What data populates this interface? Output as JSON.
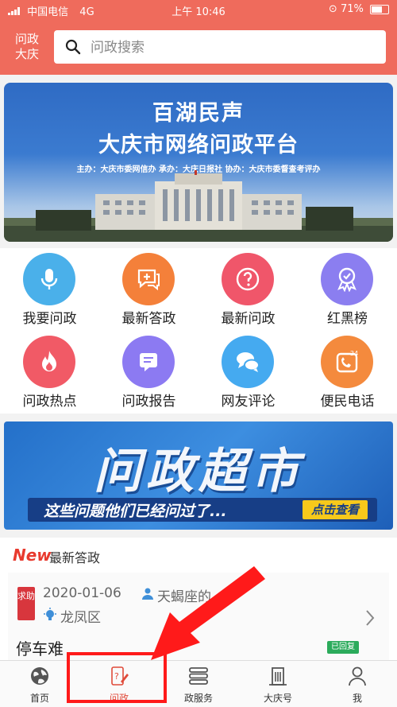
{
  "status_bar": {
    "carrier": "中国电信",
    "network": "4G",
    "time": "上午 10:46",
    "battery": "71%",
    "battery_level": 0.71
  },
  "header": {
    "title": "问政大庆",
    "search_placeholder": "问政搜索"
  },
  "hero": {
    "title_line1": "百湖民声",
    "title_line2": "大庆市网络问政平台",
    "sponsors": "主办：大庆市委网信办   承办：大庆日报社   协办：大庆市委督查考评办"
  },
  "grid": [
    {
      "label": "我要问政",
      "icon": "microphone-icon",
      "color": "#4ab0ea"
    },
    {
      "label": "最新答政",
      "icon": "chat-plus-icon",
      "color": "#f4803a"
    },
    {
      "label": "最新问政",
      "icon": "question-icon",
      "color": "#f0566a"
    },
    {
      "label": "红黑榜",
      "icon": "medal-icon",
      "color": "#8b7ef0"
    },
    {
      "label": "问政热点",
      "icon": "flame-icon",
      "color": "#f15a66"
    },
    {
      "label": "问政报告",
      "icon": "report-icon",
      "color": "#8c7af2"
    },
    {
      "label": "网友评论",
      "icon": "comments-icon",
      "color": "#45aaf0"
    },
    {
      "label": "便民电话",
      "icon": "phone-24-icon",
      "color": "#f48a3d"
    }
  ],
  "banner2": {
    "title": "问政超市",
    "subtitle": "这些问题他们已经问过了...",
    "button": "点击查看"
  },
  "answers": {
    "badge": "New",
    "section_title": "最新答政",
    "item": {
      "tag": "求助",
      "date": "2020-01-06",
      "user": "天蝎座的",
      "district": "龙凤区",
      "title": "停车难",
      "status": "已回复"
    }
  },
  "tabbar": [
    {
      "label": "首页",
      "icon": "globe-icon"
    },
    {
      "label": "问政",
      "icon": "ask-icon",
      "active": true
    },
    {
      "label": "政服务",
      "icon": "server-icon"
    },
    {
      "label": "大庆号",
      "icon": "building-icon"
    },
    {
      "label": "我",
      "icon": "user-icon"
    }
  ]
}
